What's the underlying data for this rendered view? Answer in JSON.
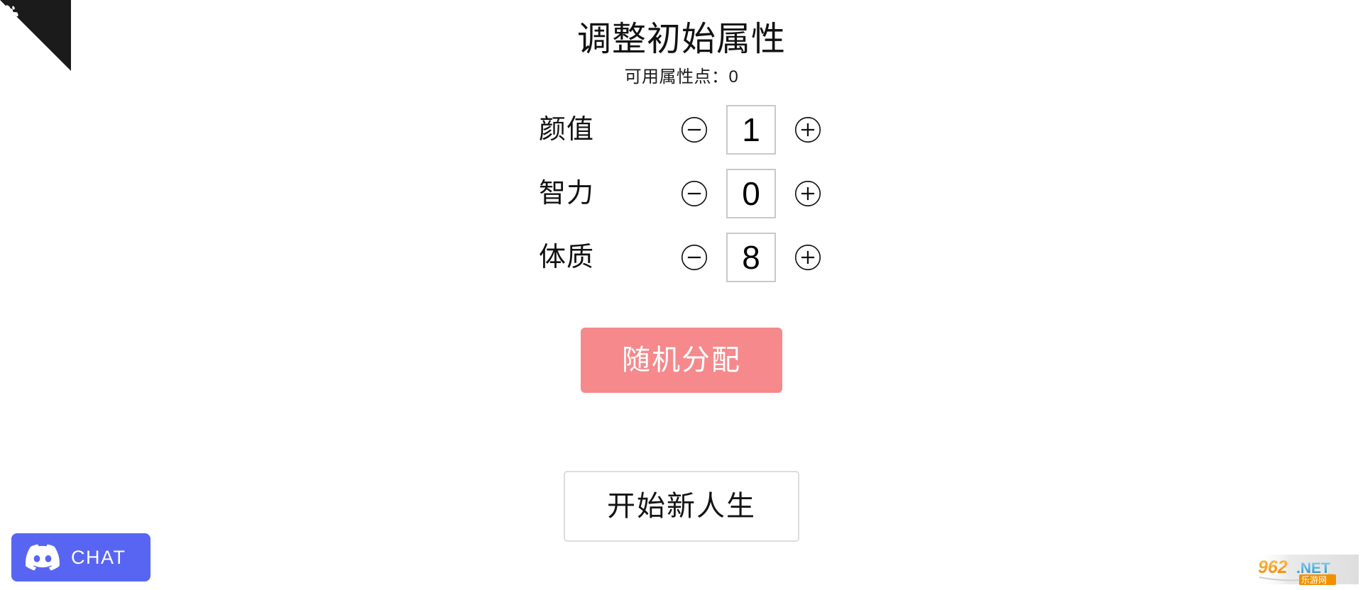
{
  "app": {
    "title": "调整初始属性",
    "points_label": "可用属性点：0"
  },
  "attributes": {
    "rows": [
      {
        "label": "颜值",
        "value": "1",
        "decrement_icon": "minus-circle-icon",
        "increment_icon": "plus-circle-icon"
      },
      {
        "label": "智力",
        "value": "0",
        "decrement_icon": "minus-circle-icon",
        "increment_icon": "plus-circle-icon"
      },
      {
        "label": "体质",
        "value": "8",
        "decrement_icon": "minus-circle-icon",
        "increment_icon": "plus-circle-icon"
      }
    ]
  },
  "actions": {
    "random_label": "随机分配",
    "start_label": "开始新人生"
  },
  "corner_ribbon": {
    "icon": "github-octocat-icon"
  },
  "discord": {
    "label": "CHAT",
    "icon": "discord-icon"
  },
  "watermark": {
    "number": "962",
    "domain": ".NET",
    "site_name": "乐游网"
  },
  "colors": {
    "background": "#ffffff",
    "text": "#111111",
    "random_button": "#f5898c",
    "random_button_text": "#ffffff",
    "start_button_border": "#dddddd",
    "value_box_border": "#c9c9c9",
    "discord_blurple": "#5865f2",
    "ribbon_black": "#1b1b1b",
    "watermark_orange": "#f29100",
    "watermark_blue": "#2e9fd6"
  }
}
